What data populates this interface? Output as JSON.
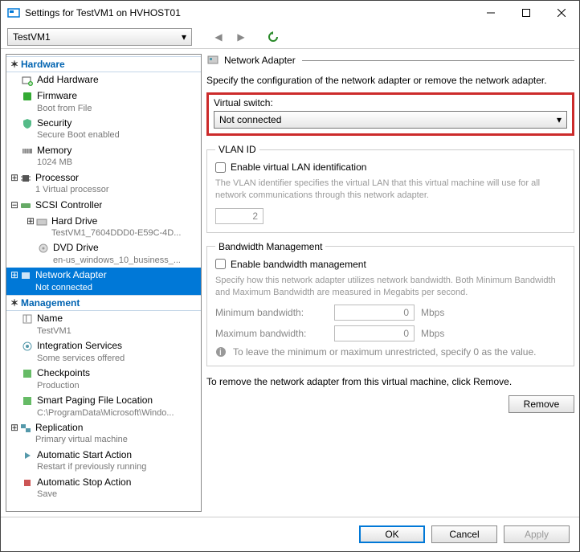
{
  "window": {
    "title": "Settings for TestVM1 on HVHOST01"
  },
  "vm_selector": {
    "value": "TestVM1"
  },
  "sidebar": {
    "hardware_header": "Hardware",
    "management_header": "Management",
    "hardware": [
      {
        "label": "Add Hardware",
        "sub": ""
      },
      {
        "label": "Firmware",
        "sub": "Boot from File"
      },
      {
        "label": "Security",
        "sub": "Secure Boot enabled"
      },
      {
        "label": "Memory",
        "sub": "1024 MB"
      },
      {
        "label": "Processor",
        "sub": "1 Virtual processor"
      },
      {
        "label": "SCSI Controller",
        "sub": ""
      },
      {
        "label": "Hard Drive",
        "sub": "TestVM1_7604DDD0-E59C-4D..."
      },
      {
        "label": "DVD Drive",
        "sub": "en-us_windows_10_business_..."
      },
      {
        "label": "Network Adapter",
        "sub": "Not connected"
      }
    ],
    "management": [
      {
        "label": "Name",
        "sub": "TestVM1"
      },
      {
        "label": "Integration Services",
        "sub": "Some services offered"
      },
      {
        "label": "Checkpoints",
        "sub": "Production"
      },
      {
        "label": "Smart Paging File Location",
        "sub": "C:\\ProgramData\\Microsoft\\Windo..."
      },
      {
        "label": "Replication",
        "sub": "Primary virtual machine"
      },
      {
        "label": "Automatic Start Action",
        "sub": "Restart if previously running"
      },
      {
        "label": "Automatic Stop Action",
        "sub": "Save"
      }
    ]
  },
  "panel": {
    "title": "Network Adapter",
    "desc": "Specify the configuration of the network adapter or remove the network adapter.",
    "switch_label": "Virtual switch:",
    "switch_value": "Not connected",
    "vlan": {
      "legend": "VLAN ID",
      "checkbox": "Enable virtual LAN identification",
      "hint": "The VLAN identifier specifies the virtual LAN that this virtual machine will use for all network communications through this network adapter.",
      "value": "2"
    },
    "bw": {
      "legend": "Bandwidth Management",
      "checkbox": "Enable bandwidth management",
      "hint": "Specify how this network adapter utilizes network bandwidth. Both Minimum Bandwidth and Maximum Bandwidth are measured in Megabits per second.",
      "min_label": "Minimum bandwidth:",
      "max_label": "Maximum bandwidth:",
      "min_value": "0",
      "max_value": "0",
      "unit": "Mbps",
      "info": "To leave the minimum or maximum unrestricted, specify 0 as the value."
    },
    "remove_text": "To remove the network adapter from this virtual machine, click Remove.",
    "remove_btn": "Remove"
  },
  "footer": {
    "ok": "OK",
    "cancel": "Cancel",
    "apply": "Apply"
  }
}
